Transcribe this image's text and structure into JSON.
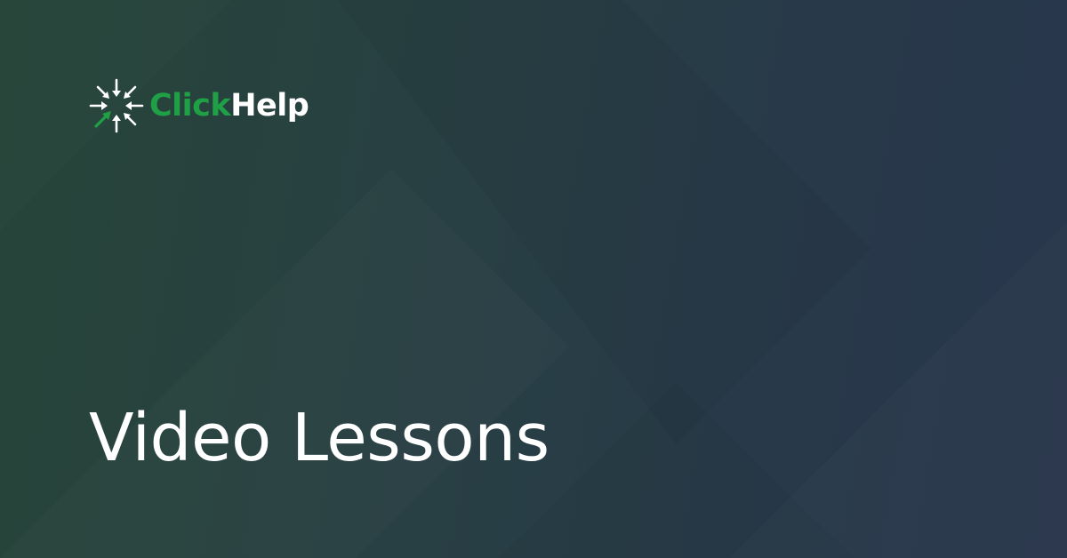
{
  "brand": {
    "name_part1": "Click",
    "name_part2": "Help",
    "icon": "click-burst-logo-icon",
    "colors": {
      "brand_green": "#1fa046",
      "brand_white": "#ffffff"
    }
  },
  "title": "Video Lessons",
  "background": {
    "gradient_start": "#264538",
    "gradient_end": "#29364c"
  }
}
